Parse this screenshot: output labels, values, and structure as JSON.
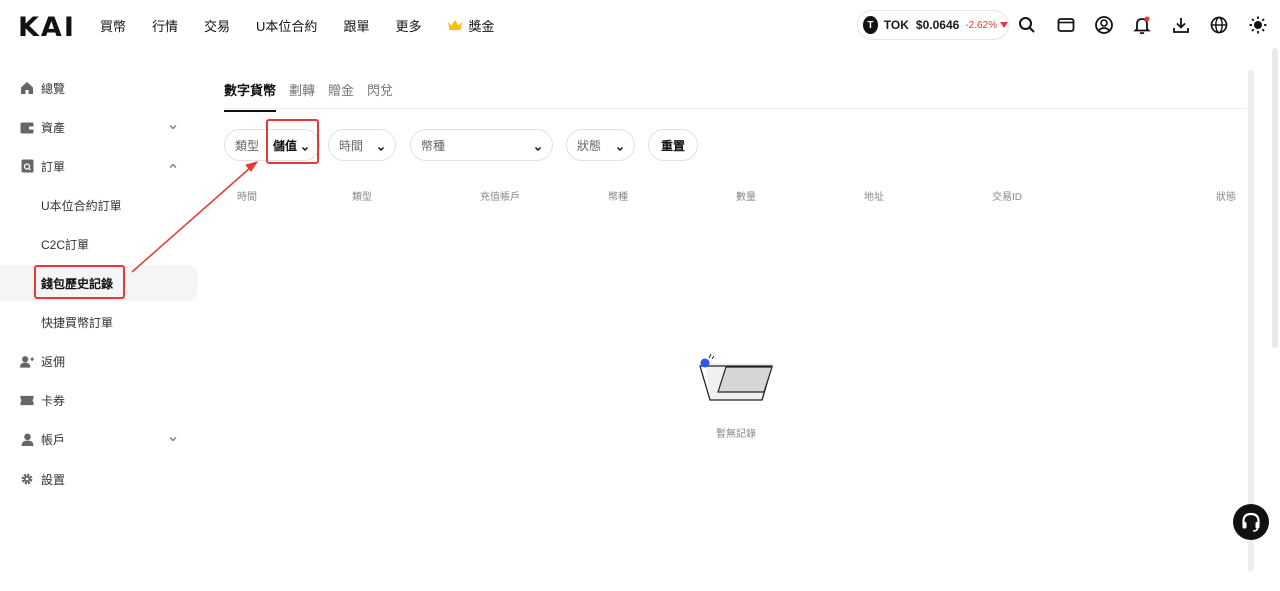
{
  "brand": {
    "logo_text": "KAI"
  },
  "nav": {
    "items": [
      {
        "label": "買幣"
      },
      {
        "label": "行情"
      },
      {
        "label": "交易"
      },
      {
        "label": "U本位合約"
      },
      {
        "label": "跟單"
      },
      {
        "label": "更多"
      },
      {
        "label": "獎金"
      }
    ]
  },
  "ticker": {
    "icon_letter": "T",
    "symbol": "TOK",
    "price": "$0.0646",
    "change": "-2.62%"
  },
  "top_icons": [
    "search-icon",
    "wallet-icon",
    "user-icon",
    "bell-icon",
    "download-icon",
    "globe-icon",
    "theme-icon"
  ],
  "sidebar": {
    "items": [
      {
        "label": "總覽",
        "icon": "home-icon"
      },
      {
        "label": "資產",
        "icon": "wallet-icon"
      },
      {
        "label": "訂單",
        "icon": "order-icon"
      },
      {
        "label": "U本位合約訂單"
      },
      {
        "label": "C2C訂單"
      },
      {
        "label": "錢包歷史記錄"
      },
      {
        "label": "快捷買幣訂單"
      },
      {
        "label": "返佣",
        "icon": "rebate-icon"
      },
      {
        "label": "卡券",
        "icon": "ticket-icon"
      },
      {
        "label": "帳戶",
        "icon": "account-icon"
      },
      {
        "label": "設置",
        "icon": "settings-icon"
      }
    ]
  },
  "tabs": [
    {
      "label": "數字貨幣"
    },
    {
      "label": "劃轉"
    },
    {
      "label": "贈金"
    },
    {
      "label": "閃兌"
    }
  ],
  "filters": {
    "type_label": "類型",
    "type_value": "儲值",
    "time_label": "時間",
    "currency_label": "幣種",
    "status_label": "狀態",
    "reset_label": "重置"
  },
  "table": {
    "columns": [
      "時間",
      "類型",
      "充值帳戶",
      "幣種",
      "數量",
      "地址",
      "交易ID",
      "狀態"
    ]
  },
  "empty": {
    "text": "暫無記錄"
  },
  "colors": {
    "highlight": "#e53935",
    "accent": "#111111",
    "negative": "#e53935"
  }
}
